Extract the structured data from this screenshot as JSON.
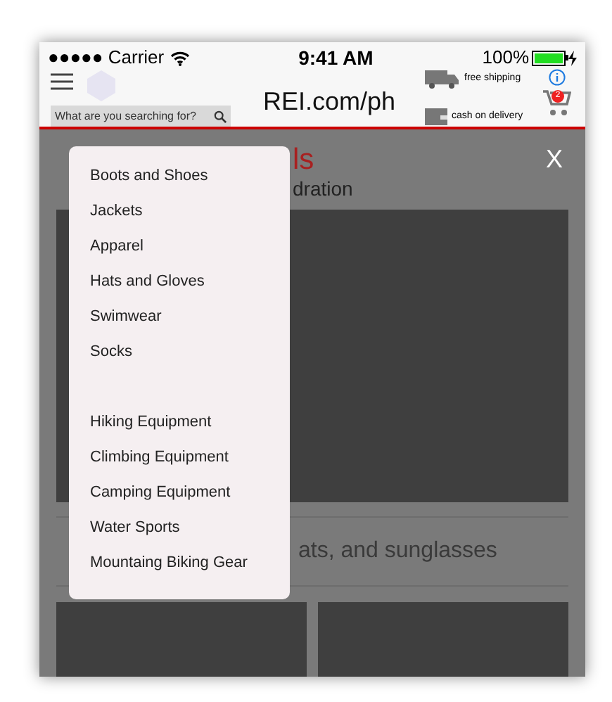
{
  "status_bar": {
    "carrier": "●●●●● Carrier",
    "time": "9:41 AM",
    "battery": "100%"
  },
  "header": {
    "search": {
      "placeholder": "What are you searching for?"
    },
    "title": "REI.com/ph",
    "shipping": "free shipping",
    "payment": "cash on delivery",
    "cart_count": "2"
  },
  "page": {
    "title_fragment": "ls",
    "subtitle_fragment": "dration",
    "section_fragment": "ats, and sunglasses"
  },
  "overlay": {
    "close": "X"
  },
  "menu": {
    "groups": [
      [
        "Boots and Shoes",
        "Jackets",
        "Apparel",
        "Hats and Gloves",
        "Swimwear",
        "Socks"
      ],
      [
        "Hiking Equipment",
        "Climbing Equipment",
        "Camping Equipment",
        "Water Sports",
        "Mountaing Biking Gear"
      ]
    ]
  }
}
